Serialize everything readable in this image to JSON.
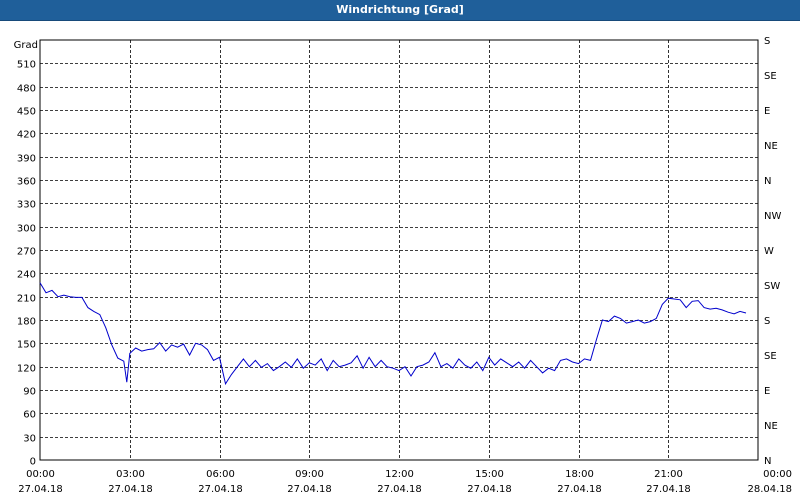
{
  "window": {
    "title": "Windrichtung [Grad]"
  },
  "chart_data": {
    "type": "line",
    "title": "Windrichtung [Grad]",
    "ylabel": "Grad",
    "ylim": [
      0,
      540
    ],
    "xlim_hours": [
      0,
      24
    ],
    "yticks": [
      0,
      30,
      60,
      90,
      120,
      150,
      180,
      210,
      240,
      270,
      300,
      330,
      360,
      390,
      420,
      450,
      480,
      510
    ],
    "right_axis_ticks": [
      {
        "value": 0,
        "label": "N"
      },
      {
        "value": 45,
        "label": "NE"
      },
      {
        "value": 90,
        "label": "E"
      },
      {
        "value": 135,
        "label": "SE"
      },
      {
        "value": 180,
        "label": "S"
      },
      {
        "value": 225,
        "label": "SW"
      },
      {
        "value": 270,
        "label": "W"
      },
      {
        "value": 315,
        "label": "NW"
      },
      {
        "value": 360,
        "label": "N"
      },
      {
        "value": 405,
        "label": "NE"
      },
      {
        "value": 450,
        "label": "E"
      },
      {
        "value": 495,
        "label": "SE"
      },
      {
        "value": 540,
        "label": "S"
      }
    ],
    "xticks": [
      {
        "h": 0,
        "time": "00:00",
        "date": "27.04.18"
      },
      {
        "h": 3,
        "time": "03:00",
        "date": "27.04.18"
      },
      {
        "h": 6,
        "time": "06:00",
        "date": "27.04.18"
      },
      {
        "h": 9,
        "time": "09:00",
        "date": "27.04.18"
      },
      {
        "h": 12,
        "time": "12:00",
        "date": "27.04.18"
      },
      {
        "h": 15,
        "time": "15:00",
        "date": "27.04.18"
      },
      {
        "h": 18,
        "time": "18:00",
        "date": "27.04.18"
      },
      {
        "h": 21,
        "time": "21:00",
        "date": "27.04.18"
      },
      {
        "h": 24,
        "time": "00:00",
        "date": "28.04.18"
      }
    ],
    "grid": true,
    "line_color": "#0000cc",
    "series": [
      {
        "x_hours": [
          0,
          0.2,
          0.4,
          0.6,
          0.8,
          1.0,
          1.2,
          1.4,
          1.6,
          1.8,
          2.0,
          2.2,
          2.4,
          2.6,
          2.8,
          2.9,
          3.0,
          3.2,
          3.4,
          3.6,
          3.8,
          4.0,
          4.2,
          4.4,
          4.6,
          4.8,
          5.0,
          5.2,
          5.4,
          5.6,
          5.8,
          6.0,
          6.2,
          6.4,
          6.6,
          6.8,
          7.0,
          7.2,
          7.4,
          7.6,
          7.8,
          8.0,
          8.2,
          8.4,
          8.6,
          8.8,
          9.0,
          9.2,
          9.4,
          9.6,
          9.8,
          10.0,
          10.2,
          10.4,
          10.6,
          10.8,
          11.0,
          11.2,
          11.4,
          11.6,
          11.8,
          12.0,
          12.2,
          12.4,
          12.6,
          12.8,
          13.0,
          13.2,
          13.4,
          13.6,
          13.8,
          14.0,
          14.2,
          14.4,
          14.6,
          14.8,
          15.0,
          15.2,
          15.4,
          15.6,
          15.8,
          16.0,
          16.2,
          16.4,
          16.6,
          16.8,
          17.0,
          17.2,
          17.4,
          17.6,
          17.8,
          18.0,
          18.2,
          18.4,
          18.6,
          18.8,
          19.0,
          19.2,
          19.4,
          19.6,
          19.8,
          20.0,
          20.2,
          20.4,
          20.6,
          20.8,
          21.0,
          21.2,
          21.4,
          21.6,
          21.8,
          22.0,
          22.2,
          22.4,
          22.6,
          22.8,
          23.0,
          23.2,
          23.4,
          23.6,
          23.8
        ],
        "values": [
          228,
          215,
          218,
          210,
          212,
          210,
          209,
          209,
          196,
          191,
          187,
          170,
          148,
          131,
          127,
          100,
          137,
          144,
          140,
          142,
          143,
          151,
          140,
          148,
          145,
          149,
          135,
          150,
          148,
          142,
          128,
          132,
          98,
          110,
          120,
          130,
          120,
          128,
          119,
          124,
          115,
          120,
          126,
          119,
          130,
          118,
          125,
          122,
          130,
          115,
          128,
          120,
          122,
          125,
          134,
          118,
          132,
          120,
          128,
          120,
          118,
          115,
          120,
          108,
          120,
          122,
          126,
          138,
          120,
          124,
          118,
          130,
          122,
          118,
          126,
          115,
          132,
          122,
          130,
          125,
          120,
          126,
          118,
          128,
          120,
          112,
          118,
          115,
          128,
          130,
          126,
          124,
          130,
          128,
          155,
          180,
          178,
          185,
          182,
          176,
          178,
          180,
          176,
          178,
          182,
          200,
          208,
          207,
          206,
          196,
          204,
          205,
          196,
          194,
          195,
          193,
          190,
          188,
          191,
          189
        ]
      }
    ]
  }
}
